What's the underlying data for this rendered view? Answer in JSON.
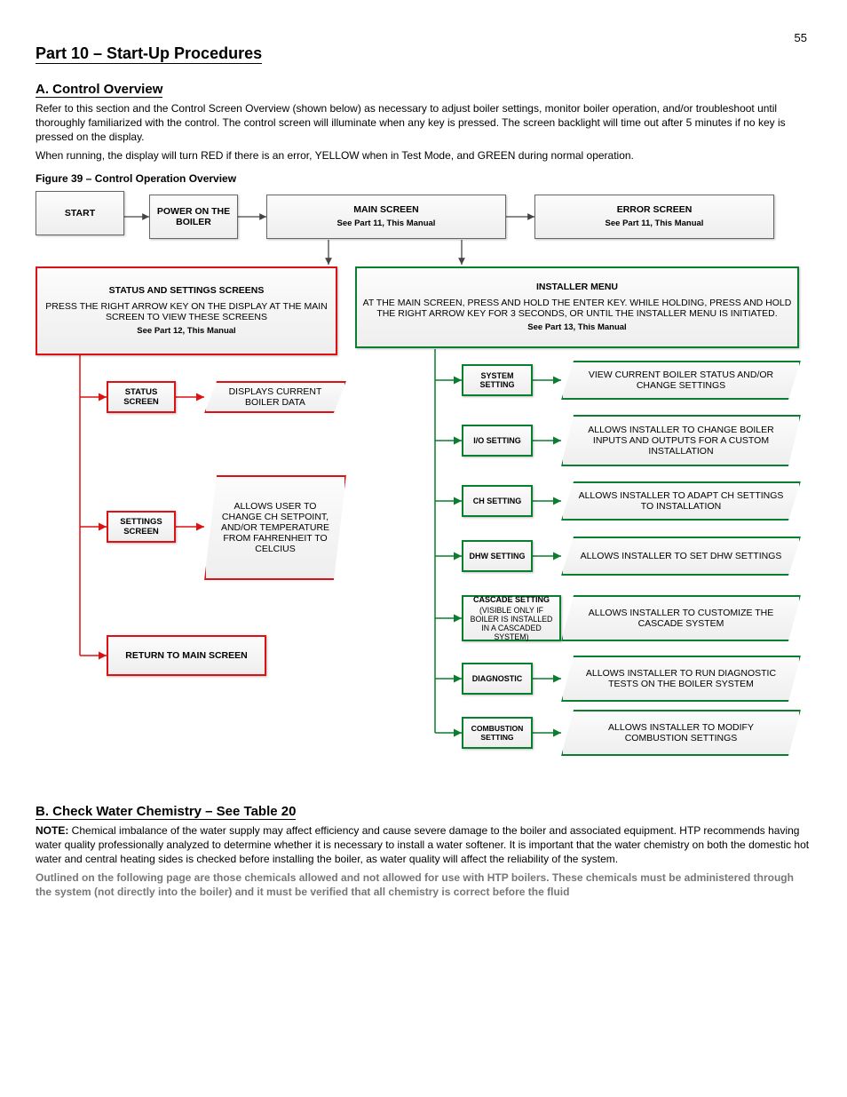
{
  "page_number": "55",
  "h1": "Part 10 – Start-Up Procedures",
  "h2a": "A. Control Overview",
  "overview_p1": "Refer to this section and the Control Screen Overview (shown below) as necessary to adjust boiler settings, monitor boiler operation, and/or troubleshoot until thoroughly familiarized with the control. The control screen will illuminate when any key is pressed. The screen backlight will time out after 5 minutes if no key is pressed on the display.",
  "overview_p2": "When running, the display will turn RED if there is an error, YELLOW when in Test Mode, and GREEN during normal operation.",
  "fig_title": "Figure 39 – Control Operation Overview",
  "top": {
    "start": "START",
    "power": "POWER ON THE BOILER",
    "main": "MAIN SCREEN",
    "seeref_main": "See Part 11, This Manual",
    "error": "ERROR SCREEN",
    "seeref_error": "See Part 11, This Manual"
  },
  "userpath": {
    "header": "STATUS AND SETTINGS SCREENS",
    "instr": "PRESS THE RIGHT ARROW KEY ON THE DISPLAY AT THE MAIN SCREEN TO VIEW THESE SCREENS",
    "seeref": "See Part 12, This Manual",
    "status": "STATUS SCREEN",
    "status_desc": "DISPLAYS CURRENT BOILER DATA",
    "settings": "SETTINGS SCREEN",
    "settings_desc": "ALLOWS USER TO CHANGE CH SETPOINT, AND/OR TEMPERATURE FROM FAHRENHEIT TO CELCIUS",
    "return": "RETURN TO MAIN SCREEN"
  },
  "instpath": {
    "header": "INSTALLER MENU",
    "instr": "AT THE MAIN SCREEN, PRESS AND HOLD THE ENTER KEY. WHILE HOLDING, PRESS AND HOLD THE RIGHT ARROW KEY FOR 3 SECONDS, OR UNTIL THE INSTALLER MENU IS INITIATED.",
    "seeref": "See Part 13, This Manual",
    "rows": [
      {
        "label": "SYSTEM SETTING",
        "desc": "VIEW CURRENT BOILER STATUS AND/OR CHANGE SETTINGS"
      },
      {
        "label": "I/O SETTING",
        "desc": "ALLOWS INSTALLER TO CHANGE BOILER INPUTS AND OUTPUTS FOR A CUSTOM INSTALLATION"
      },
      {
        "label": "CH SETTING",
        "desc": "ALLOWS INSTALLER TO ADAPT CH SETTINGS TO INSTALLATION"
      },
      {
        "label": "DHW SETTING",
        "desc": "ALLOWS INSTALLER TO SET DHW SETTINGS"
      },
      {
        "label": "CASCADE SETTING",
        "desc": "ALLOWS INSTALLER TO CUSTOMIZE THE  CASCADE SYSTEM",
        "note": "(VISIBLE ONLY IF BOILER IS INSTALLED IN A CASCADED SYSTEM)"
      },
      {
        "label": "DIAGNOSTIC",
        "desc": "ALLOWS INSTALLER TO RUN DIAGNOSTIC TESTS ON THE BOILER SYSTEM"
      },
      {
        "label": "COMBUSTION SETTING",
        "desc": "ALLOWS INSTALLER TO MODIFY COMBUSTION SETTINGS"
      }
    ]
  },
  "h2b": "B. Check Water Chemistry – See Table 20",
  "note_label": "NOTE:",
  "note_text": " Chemical imbalance of the water supply may affect efficiency and cause severe damage to the boiler and associated equipment. HTP recommends having water quality professionally analyzed to determine whether it is necessary to install a water softener. It is important that the water chemistry on both the domestic hot water and central heating sides is checked before installing the boiler, as water quality will affect the reliability of the system.",
  "disabled_text": "Outlined on the following page are those chemicals allowed and not allowed for use with HTP boilers. These chemicals must be administered through the system (not directly into the boiler) and it must be verified that all chemistry is correct before the fluid"
}
